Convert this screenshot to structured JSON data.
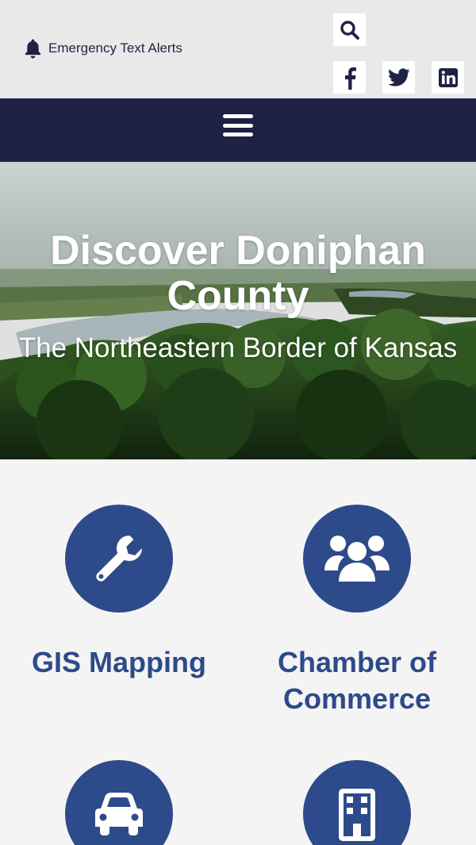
{
  "topbar": {
    "alert_label": "Emergency Text Alerts",
    "icons": {
      "alert": "bell-icon",
      "search": "search-icon",
      "facebook": "facebook-icon",
      "twitter": "twitter-icon",
      "linkedin": "linkedin-icon"
    }
  },
  "nav": {
    "menu_icon": "hamburger-menu-icon"
  },
  "hero": {
    "title": "Discover Doniphan County",
    "subtitle": "The Northeastern Border of Kansas"
  },
  "quick_links": [
    {
      "label": "GIS Mapping",
      "icon": "wrench-icon"
    },
    {
      "label": "Chamber of Commerce",
      "icon": "users-icon"
    },
    {
      "label": "",
      "icon": "car-icon"
    },
    {
      "label": "",
      "icon": "building-icon"
    }
  ],
  "colors": {
    "topbar_bg": "#e9e9e9",
    "nav_bg": "#1e2143",
    "accent_blue": "#2d4a8a",
    "page_bg": "#f4f4f4"
  }
}
